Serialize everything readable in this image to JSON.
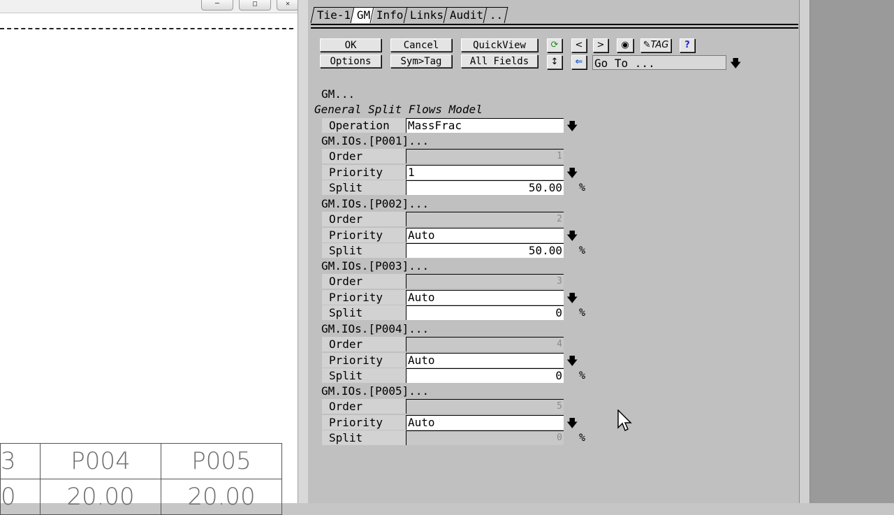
{
  "left_pane": {
    "table": {
      "row1": [
        "3",
        "P004",
        "P005"
      ],
      "row2": [
        "0",
        "20.00",
        "20.00"
      ]
    }
  },
  "tabs": [
    {
      "label": "Tie-1",
      "active": false
    },
    {
      "label": "GM",
      "active": true
    },
    {
      "label": "Info",
      "active": false
    },
    {
      "label": "Links",
      "active": false
    },
    {
      "label": "Audit",
      "active": false
    },
    {
      "label": "..",
      "active": false
    }
  ],
  "toolbar": {
    "ok": "OK",
    "options": "Options",
    "cancel": "Cancel",
    "symtag": "Sym>Tag",
    "quickview": "QuickView",
    "allfields": "All Fields",
    "prev": "<",
    "next": ">",
    "tag": "TAG",
    "help": "?",
    "goto_value": "Go To ..."
  },
  "form": {
    "section": "GM...",
    "model_title": "General Split Flows Model",
    "operation_label": "Operation",
    "operation_value": "MassFrac",
    "order_label": "Order",
    "priority_label": "Priority",
    "split_label": "Split",
    "unit": "%",
    "ios": [
      {
        "header": "GM.IOs.[P001]...",
        "order": "1",
        "priority": "1",
        "split": "50.00"
      },
      {
        "header": "GM.IOs.[P002]...",
        "order": "2",
        "priority": "Auto",
        "split": "50.00"
      },
      {
        "header": "GM.IOs.[P003]...",
        "order": "3",
        "priority": "Auto",
        "split": "0"
      },
      {
        "header": "GM.IOs.[P004]...",
        "order": "4",
        "priority": "Auto",
        "split": "0"
      },
      {
        "header": "GM.IOs.[P005]...",
        "order": "5",
        "priority": "Auto",
        "split": "0"
      }
    ]
  },
  "colors": {
    "dialog_bg": "#c0c0c0",
    "field_bg": "#ffffff",
    "readonly_bg": "#c8c8c8"
  }
}
